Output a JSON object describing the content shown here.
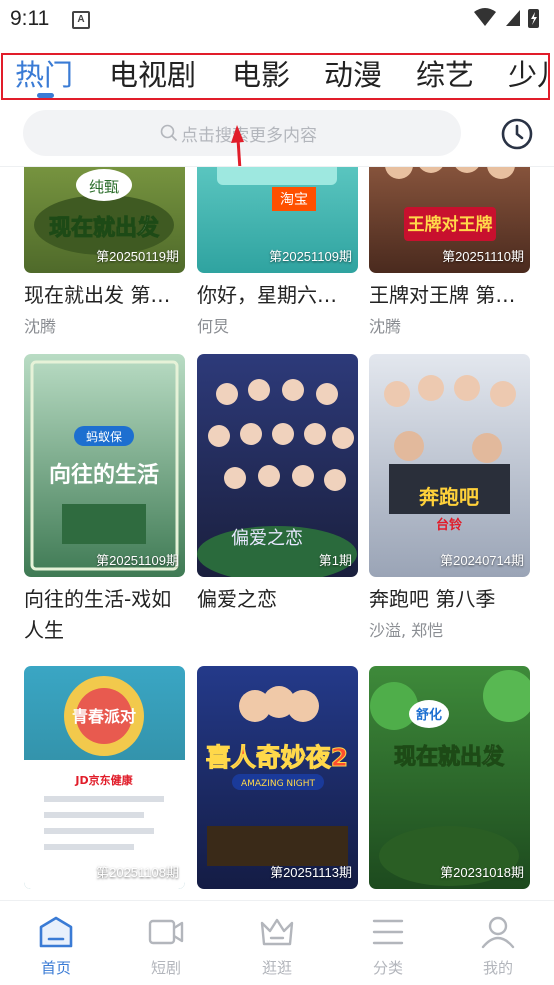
{
  "status_bar": {
    "time": "9:11",
    "a_badge": "A"
  },
  "tabs": [
    {
      "label": "热门",
      "active": true
    },
    {
      "label": "电视剧"
    },
    {
      "label": "电影"
    },
    {
      "label": "动漫"
    },
    {
      "label": "综艺"
    },
    {
      "label": "少儿"
    }
  ],
  "search": {
    "placeholder": "点击搜索更多内容"
  },
  "posters": {
    "r0c0_logo": "纯甄",
    "r0c0_art": "现在就出发",
    "r0c1_art": "淘宝",
    "r0c2_art": "王牌对王牌",
    "r1c0_brand": "蚂蚁保",
    "r1c0_art": "向往的生活",
    "r1c1_art": "偏爱之恋",
    "r1c2_art": "奔跑吧",
    "r1c2_sponsor": "台铃",
    "r2c0_art": "青春派对",
    "r2c0_sponsor": "JD京东健康",
    "r2c1_art": "喜人奇妙夜2",
    "r2c1_sub": "AMAZING NIGHT",
    "r2c2_logo": "舒化",
    "r2c2_art": "现在就出发"
  },
  "grid": [
    {
      "episode": "第20250119期",
      "title": "现在就出发 第…",
      "subtitle": "沈腾",
      "bg": "#6d8a3a"
    },
    {
      "episode": "第20251109期",
      "title": "你好，星期六…",
      "subtitle": "何炅",
      "bg": "#3fb8b0"
    },
    {
      "episode": "第20251110期",
      "title": "王牌对王牌 第…",
      "subtitle": "沈腾",
      "bg": "#7a4b2e"
    },
    {
      "episode": "第20251109期",
      "title": "向往的生活-戏如人生",
      "subtitle": "",
      "bg": "#5a9a6e"
    },
    {
      "episode": "第1期",
      "title": "偏爱之恋",
      "subtitle": "",
      "bg": "#2a3566"
    },
    {
      "episode": "第20240714期",
      "title": "奔跑吧 第八季",
      "subtitle": "沙溢, 郑恺",
      "bg": "#cfd6e2"
    },
    {
      "episode": "第20251108期",
      "title": "",
      "subtitle": "",
      "bg": "#2e8fa8"
    },
    {
      "episode": "第20251113期",
      "title": "",
      "subtitle": "",
      "bg": "#1e2f6e"
    },
    {
      "episode": "第20231018期",
      "title": "",
      "subtitle": "",
      "bg": "#2f6b32"
    }
  ],
  "bottom_nav": [
    {
      "label": "首页",
      "icon": "home-icon",
      "active": true
    },
    {
      "label": "短剧",
      "icon": "video-icon"
    },
    {
      "label": "逛逛",
      "icon": "crown-icon"
    },
    {
      "label": "分类",
      "icon": "menu-icon"
    },
    {
      "label": "我的",
      "icon": "user-icon"
    }
  ],
  "colors": {
    "accent": "#3a7bd5",
    "annotation": "#e11d2a"
  }
}
